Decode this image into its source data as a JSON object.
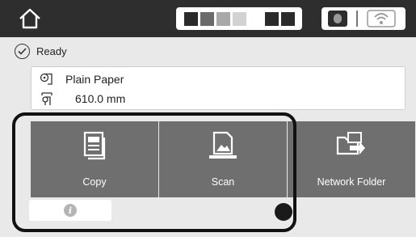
{
  "topbar": {
    "home_icon": "home-icon",
    "ink_levels": [
      {
        "color": "#2a2a2a",
        "level": 1.0
      },
      {
        "color": "#6a6a6a",
        "level": 1.0
      },
      {
        "color": "#a8a8a8",
        "level": 1.0
      },
      {
        "color": "#d2d2d2",
        "level": 1.0
      },
      {
        "color": "#2a2a2a",
        "level": 1.0
      },
      {
        "color": "#2a2a2a",
        "level": 1.0
      }
    ],
    "maintenance_icon": "maintenance-box-icon",
    "wifi_icon": "wifi-icon"
  },
  "status": {
    "icon": "check-circle-icon",
    "text": "Ready"
  },
  "paper": {
    "type_icon": "paper-roll-icon",
    "type": "Plain Paper",
    "width_icon": "paper-width-icon",
    "width": "610.0 mm"
  },
  "tiles": [
    {
      "label": "Copy",
      "icon": "copy-icon"
    },
    {
      "label": "Scan",
      "icon": "scan-icon"
    },
    {
      "label": "Network Folder",
      "icon": "network-folder-icon"
    }
  ],
  "info_button": {
    "icon": "info-icon",
    "glyph": "i"
  },
  "colors": {
    "topbar": "#2e2e2e",
    "tile": "#6f6f6f",
    "background": "#e9e9e9"
  }
}
